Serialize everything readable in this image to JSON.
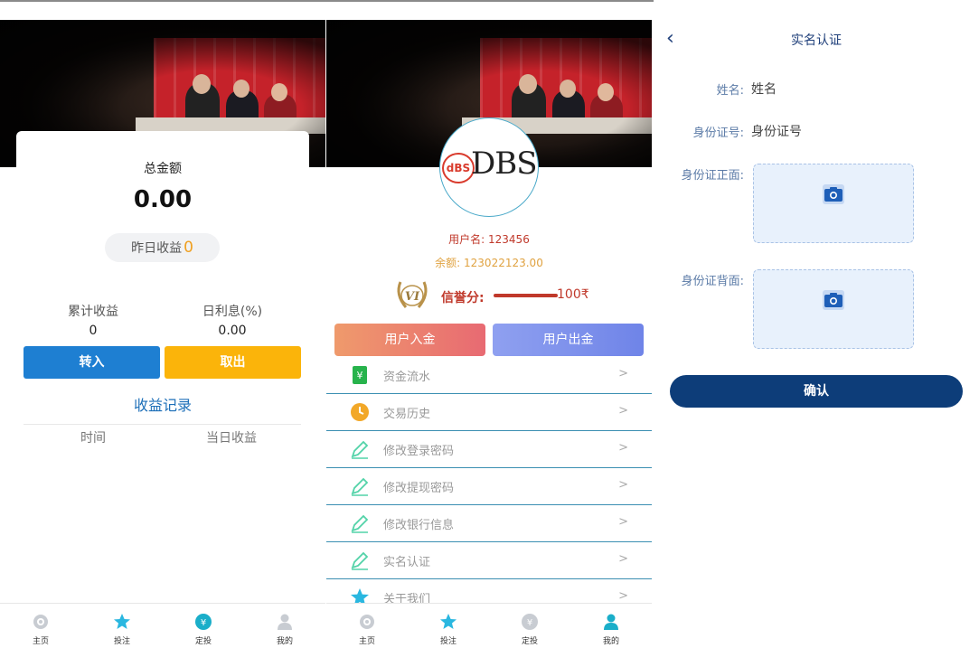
{
  "panel1": {
    "total_label": "总金额",
    "total_value": "0.00",
    "yesterday_label": "昨日收益",
    "yesterday_value": "0",
    "cumulative_label": "累计收益",
    "cumulative_value": "0",
    "daily_rate_label": "日利息(%)",
    "daily_rate_value": "0.00",
    "transfer_in_label": "转入",
    "withdraw_label": "取出",
    "records_link": "收益记录",
    "col_time": "时间",
    "col_daily": "当日收益",
    "colors": {
      "transfer_in": "#1e7fd2",
      "withdraw": "#fbb40a"
    }
  },
  "panel2": {
    "logo_badge": "dBS",
    "logo_word": "DBS",
    "username_text": "用户名: 123456",
    "balance_text": "余额: 123022123.00",
    "vip_text": "VI",
    "credit_label": "信誉分:",
    "credit_value": "100₹",
    "deposit_label": "用户入金",
    "withdraw_label": "用户出金",
    "menu": [
      {
        "label": "资金流水",
        "icon": "money-note-icon",
        "arrow": ">"
      },
      {
        "label": "交易历史",
        "icon": "clock-icon",
        "arrow": ">"
      },
      {
        "label": "修改登录密码",
        "icon": "pencil-icon",
        "arrow": ">"
      },
      {
        "label": "修改提现密码",
        "icon": "pencil-icon",
        "arrow": ">"
      },
      {
        "label": "修改银行信息",
        "icon": "pencil-icon",
        "arrow": ">"
      },
      {
        "label": "实名认证",
        "icon": "pencil-icon",
        "arrow": ">"
      },
      {
        "label": "关于我们",
        "icon": "star-icon",
        "arrow": ">"
      }
    ]
  },
  "tabs1": [
    {
      "label": "主页",
      "icon": "home-icon"
    },
    {
      "label": "投注",
      "icon": "star-icon"
    },
    {
      "label": "定投",
      "icon": "invest-icon",
      "active": true
    },
    {
      "label": "我的",
      "icon": "user-icon"
    }
  ],
  "tabs2": [
    {
      "label": "主页",
      "icon": "home-icon"
    },
    {
      "label": "投注",
      "icon": "star-icon"
    },
    {
      "label": "定投",
      "icon": "invest-icon"
    },
    {
      "label": "我的",
      "icon": "user-icon",
      "active": true
    }
  ],
  "panel3": {
    "title": "实名认证",
    "name_label": "姓名:",
    "name_placeholder": "姓名",
    "id_label": "身份证号:",
    "id_placeholder": "身份证号",
    "front_label": "身份证正面:",
    "back_label": "身份证背面:",
    "confirm_label": "确认"
  }
}
